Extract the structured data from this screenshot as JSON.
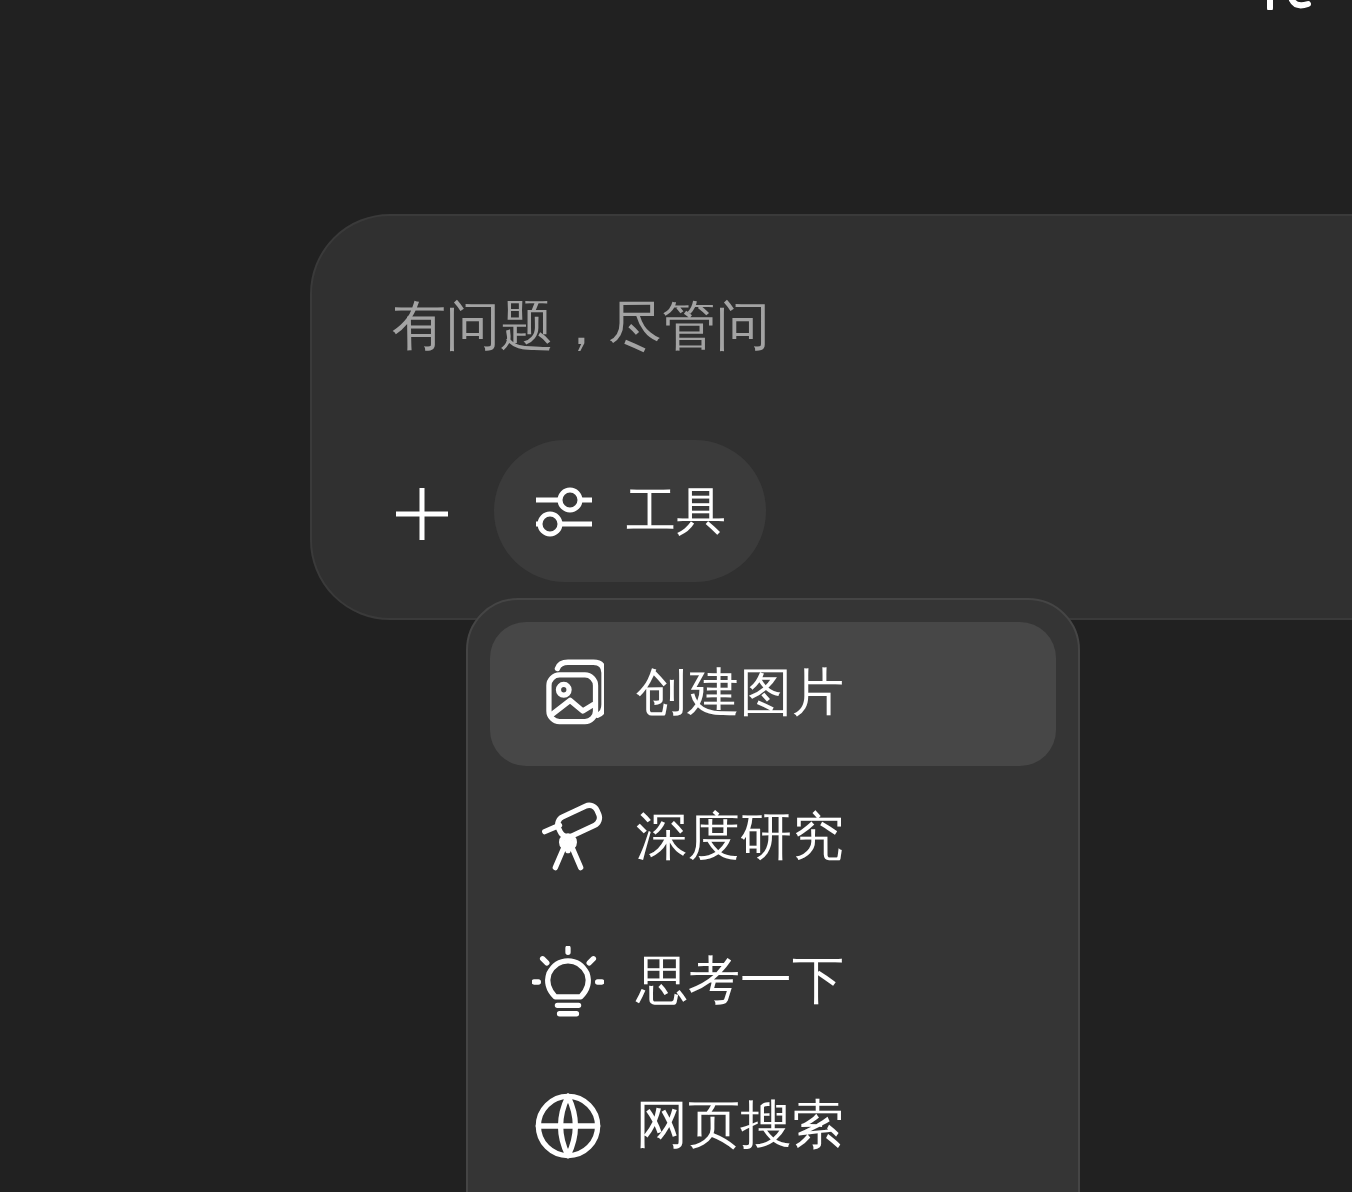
{
  "composer": {
    "placeholder": "有问题，尽管问",
    "tools_button": {
      "label": "工具"
    }
  },
  "tools_menu": {
    "items": [
      {
        "kind": "image",
        "label": "创建图片",
        "selected": true
      },
      {
        "kind": "research",
        "label": "深度研究",
        "selected": false
      },
      {
        "kind": "think",
        "label": "思考一下",
        "selected": false
      },
      {
        "kind": "web",
        "label": "网页搜索",
        "selected": false
      }
    ]
  }
}
